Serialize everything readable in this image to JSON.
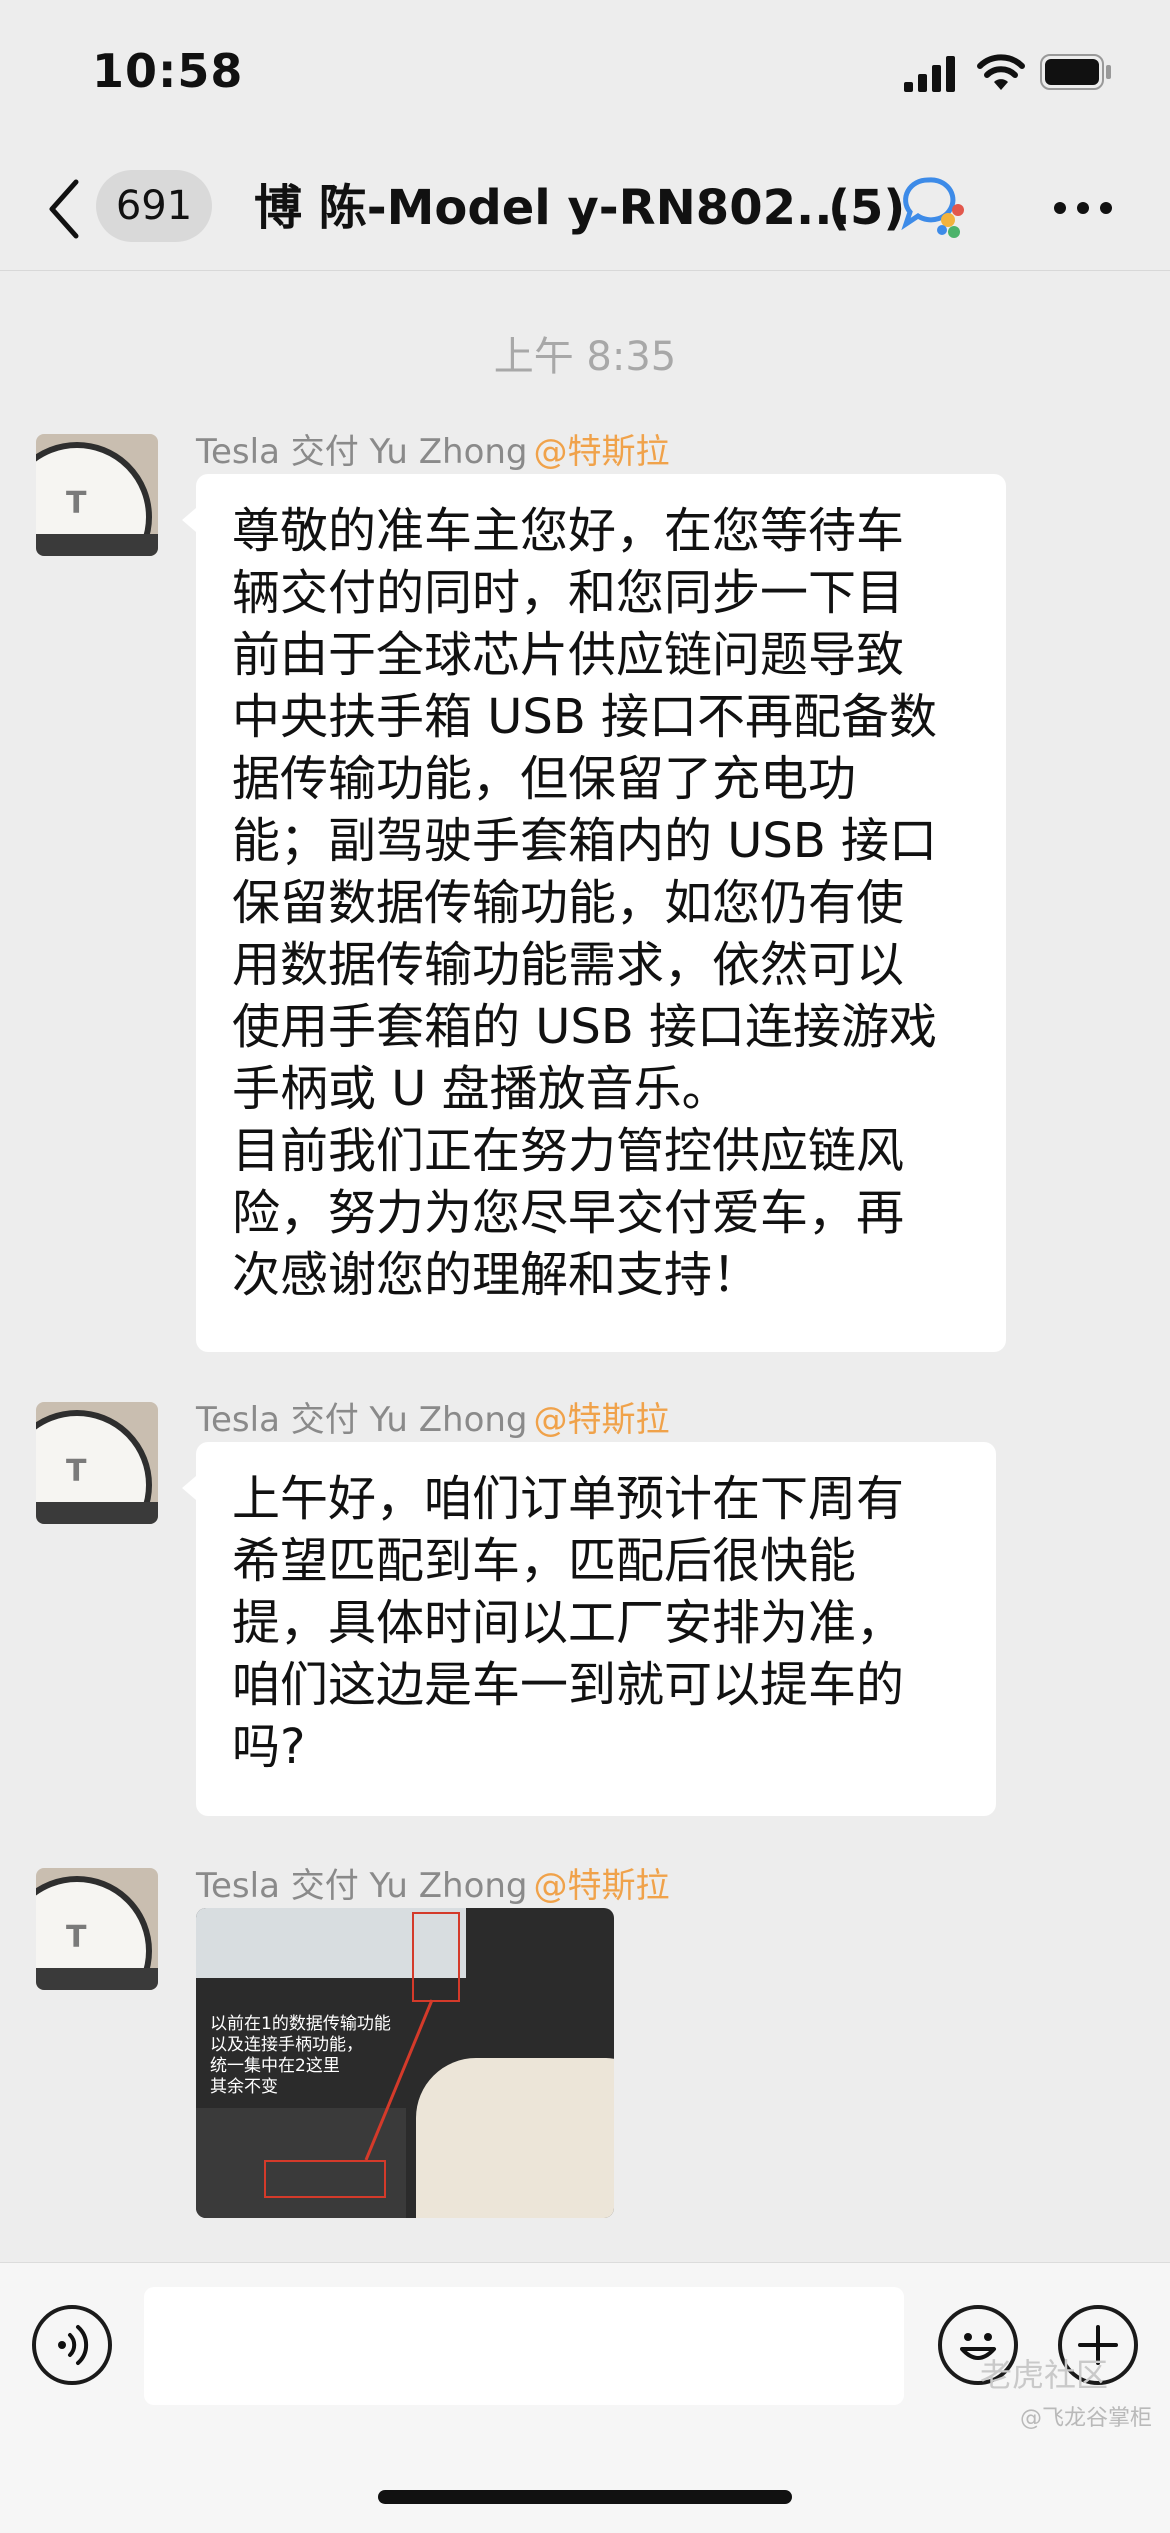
{
  "status_bar": {
    "time": "10:58"
  },
  "nav": {
    "unread_count": "691",
    "title": "博 陈-Model y-RN802...",
    "member_count": "(5)"
  },
  "conversation": {
    "timestamp": "上午 8:35",
    "messages": [
      {
        "sender": "Tesla 交付 Yu Zhong",
        "sender_tag": "@特斯拉",
        "text": "尊敬的准车主您好，在您等待车\n辆交付的同时，和您同步一下目\n前由于全球芯片供应链问题导致\n中央扶手箱 USB 接口不再配备数\n据传输功能，但保留了充电功\n能；副驾驶手套箱内的 USB 接口\n保留数据传输功能，如您仍有使\n用数据传输功能需求，依然可以\n使用手套箱的 USB 接口连接游戏\n手柄或 U 盘播放音乐。\n目前我们正在努力管控供应链风\n险，努力为您尽早交付爱车，再\n次感谢您的理解和支持！"
      },
      {
        "sender": "Tesla 交付 Yu Zhong",
        "sender_tag": "@特斯拉",
        "text": "上午好，咱们订单预计在下周有\n希望匹配到车，匹配后很快能\n提，具体时间以工厂安排为准，\n咱们这边是车一到就可以提车的\n吗?"
      },
      {
        "sender": "Tesla 交付 Yu Zhong",
        "sender_tag": "@特斯拉",
        "image_caption": "以前在1的数据传输功能\n以及连接手柄功能，\n统一集中在2这里\n其余不变"
      }
    ]
  },
  "watermark": {
    "main": "老虎社区",
    "sub": "@飞龙谷掌柜"
  },
  "icons": {
    "back": "chevron-left-icon",
    "group": "group-chat-icon",
    "more": "more-icon",
    "voice": "voice-icon",
    "emoji": "emoji-icon",
    "add": "plus-icon"
  }
}
